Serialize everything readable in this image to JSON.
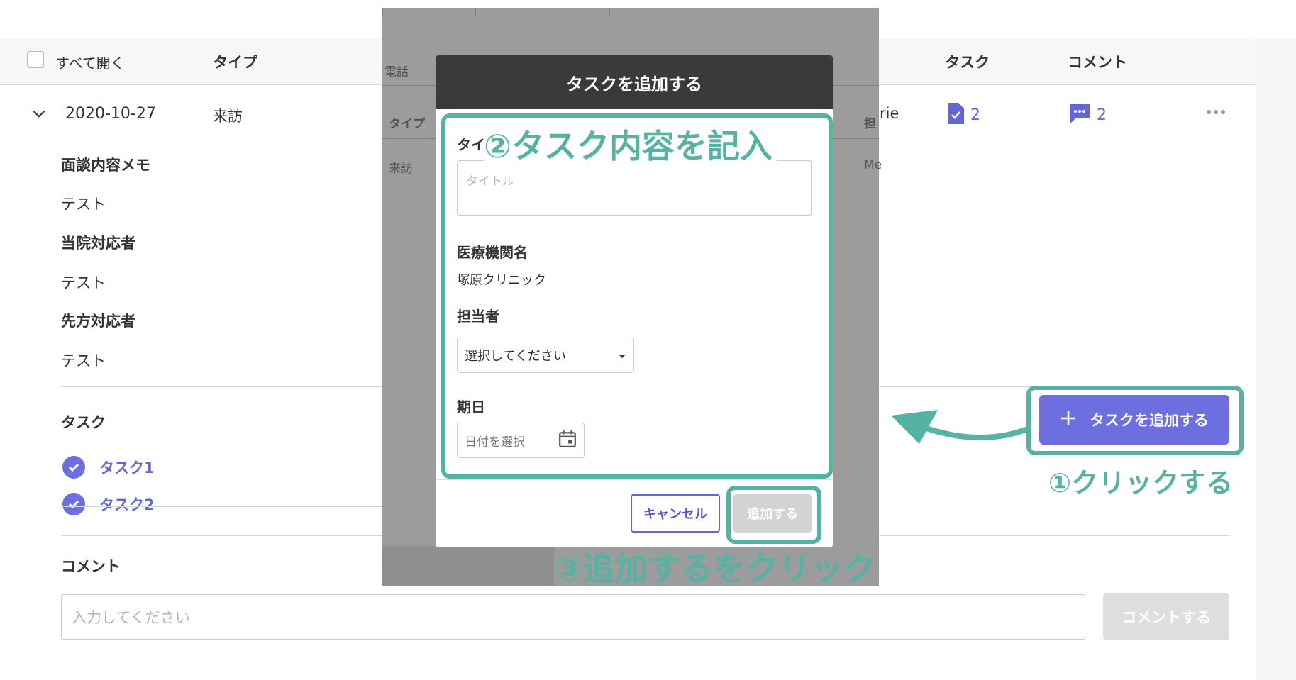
{
  "table_header": {
    "select_all": "すべて開く",
    "col_type": "タイプ",
    "col_task": "タスク",
    "col_comment": "コメント"
  },
  "row": {
    "date": "2020-10-27",
    "type": "来訪",
    "task_count": "2",
    "comment_count": "2",
    "assignee_partial": "rie"
  },
  "details": {
    "memo_label": "面談内容メモ",
    "memo_value": "テスト",
    "our_staff_label": "当院対応者",
    "our_staff_value": "テスト",
    "partner_staff_label": "先方対応者",
    "partner_staff_value": "テスト",
    "tasks_label": "タスク",
    "tasks": [
      "タスク1",
      "タスク2"
    ],
    "comment_label": "コメント",
    "comment_placeholder": "入力してください",
    "comment_button": "コメントする",
    "add_task_button": "タスクを追加する"
  },
  "backdrop_ghost": {
    "tab_phone": "電話",
    "col_type": "タイプ",
    "col_assignee": "担",
    "cell_type": "来訪",
    "cell_assignee": "Me"
  },
  "modal": {
    "title": "タスクを追加する",
    "title_label": "タイ",
    "title_placeholder": "タイトル",
    "facility_label": "医療機関名",
    "facility_value": "塚原クリニック",
    "assignee_label": "担当者",
    "assignee_placeholder": "選択してください",
    "due_label": "期日",
    "due_placeholder": "日付を選択",
    "cancel": "キャンセル",
    "submit": "追加する"
  },
  "annotations": {
    "step1": "①クリックする",
    "step2": "②タスク内容を記入",
    "step3": "③追加するをクリック",
    "color": "#56b3a3"
  },
  "colors": {
    "accent": "#6d6fe0",
    "modal_header": "#3a3a3a",
    "backdrop": "#9c9c9c"
  },
  "icons": {
    "expand": "chevron-down-icon",
    "task": "document-check-icon",
    "comment": "chat-bubble-icon",
    "more": "more-horizontal-icon",
    "check": "check-circle-icon",
    "plus": "plus-icon",
    "dropdown": "caret-down-icon",
    "calendar": "calendar-icon",
    "arrow": "curved-arrow-icon"
  }
}
